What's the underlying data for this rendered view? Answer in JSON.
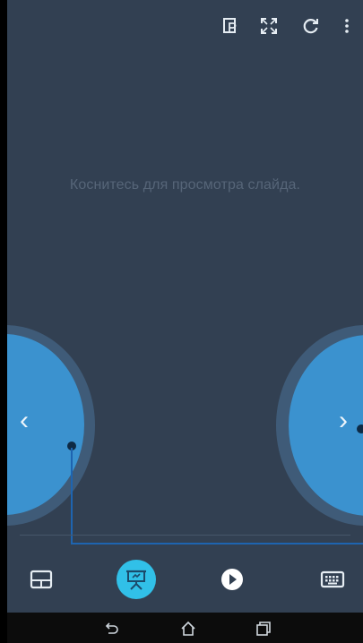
{
  "toolbar": {
    "icons": [
      "presentation-view-icon",
      "fullscreen-icon",
      "refresh-icon",
      "more-options-icon"
    ]
  },
  "main": {
    "hint_text": "Коснитесь для просмотра слайда."
  },
  "navigation": {
    "prev_label": "‹",
    "next_label": "›"
  },
  "bottom_tabs": [
    {
      "icon": "layout-icon",
      "active": false
    },
    {
      "icon": "presentation-icon",
      "active": true
    },
    {
      "icon": "play-icon",
      "active": false
    },
    {
      "icon": "keyboard-icon",
      "active": false
    }
  ],
  "system_nav": [
    "back-icon",
    "home-icon",
    "recents-icon"
  ],
  "colors": {
    "background": "#324052",
    "nav_button": "#3b92cf",
    "nav_button_ring": "#3f5b78",
    "active_tab": "#31c0e8",
    "hint_text": "#566578"
  }
}
